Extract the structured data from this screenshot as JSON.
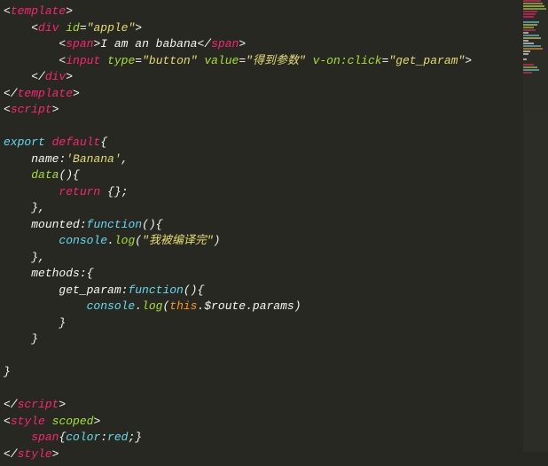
{
  "l1": {
    "tag": "template"
  },
  "l2": {
    "tag": "div",
    "attr": "id",
    "val": "\"apple\""
  },
  "l3": {
    "open": "span",
    "text": "I am an babana",
    "close": "span"
  },
  "l4": {
    "tag": "input",
    "a1": "type",
    "v1": "\"button\"",
    "a2": "value",
    "v2": "\"得到参数\"",
    "a3": "v-on:click",
    "v3": "\"get_param\""
  },
  "l5": {
    "close": "div"
  },
  "l6": {
    "close": "template"
  },
  "l7": {
    "tag": "script"
  },
  "l9": {
    "kw1": "export",
    "kw2": "default",
    "brace": "{"
  },
  "l10": {
    "prop": "name",
    "val": "'Banana'",
    "comma": ","
  },
  "l11": {
    "fn": "data",
    "paren": "(){"
  },
  "l12": {
    "kw": "return",
    "rest": " {};"
  },
  "l13": {
    "close": "},"
  },
  "l14": {
    "prop": "mounted",
    "colon": ":",
    "fn": "function",
    "paren": "(){"
  },
  "l15": {
    "obj": "console",
    "dot": ".",
    "m": "log",
    "open": "(",
    "arg": "\"我被编译完\"",
    "close": ")"
  },
  "l16": {
    "close": "},"
  },
  "l17": {
    "prop": "methods",
    "rest": ":{"
  },
  "l18": {
    "prop": "get_param",
    "colon": ":",
    "fn": "function",
    "paren": "(){"
  },
  "l19": {
    "obj": "console",
    "dot": ".",
    "m": "log",
    "open": "(",
    "this": "this",
    "rest": ".$route.params)"
  },
  "l20": {
    "close": "}"
  },
  "l21": {
    "close": "}"
  },
  "l23": {
    "close": "}"
  },
  "l25": {
    "close": "script"
  },
  "l26": {
    "tag": "style",
    "attr": "scoped"
  },
  "l27": {
    "sel": "span",
    "prop": "color",
    "val": "red",
    "rest": ";}"
  },
  "l28": {
    "close": "style"
  }
}
